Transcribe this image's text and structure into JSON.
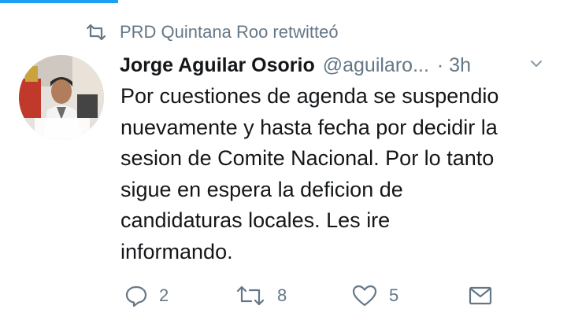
{
  "retweet": {
    "text": "PRD Quintana Roo retwitteó",
    "icon": "retweet-icon"
  },
  "tweet": {
    "author_name": "Jorge Aguilar Osorio",
    "handle": "@aguilaro...",
    "time": "· 3h",
    "lines": [
      "Por cuestiones de agenda se suspendio",
      "nuevamente y hasta fecha por decidir la",
      "sesion de Comite Nacional. Por lo tanto",
      "sigue en espera la deficion de",
      "candidaturas locales. Les ire",
      "informando."
    ]
  },
  "actions": {
    "reply_count": "2",
    "retweet_count": "8",
    "like_count": "5"
  },
  "colors": {
    "accent": "#1da1f2",
    "muted": "#657786",
    "text": "#14171a"
  }
}
